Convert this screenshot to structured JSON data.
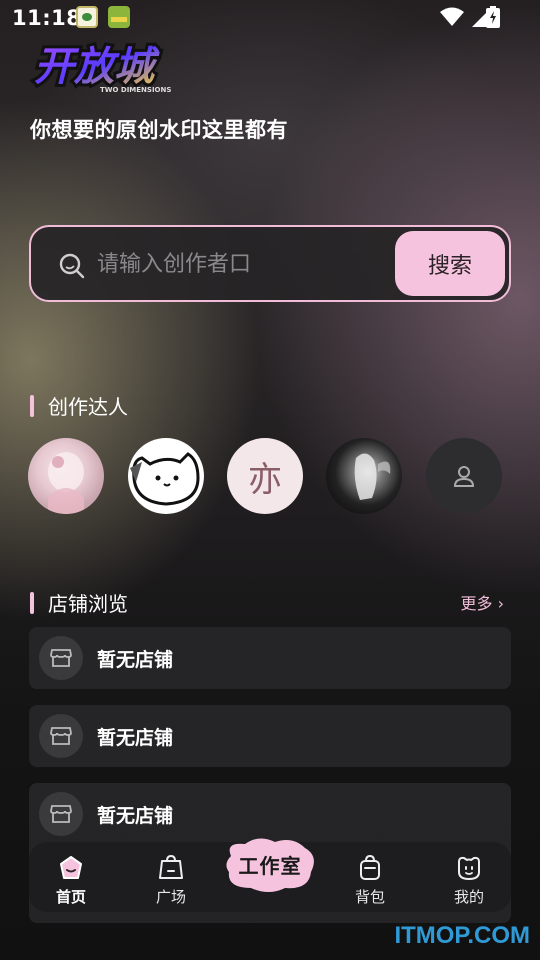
{
  "status_bar": {
    "time": "11:18"
  },
  "header": {
    "logo_text": "开放城",
    "logo_subtext": "TWO DIMENSIONS",
    "tagline": "你想要的原创水印这里都有"
  },
  "search": {
    "placeholder": "请输入创作者口",
    "button_label": "搜索"
  },
  "creators": {
    "title": "创作达人",
    "avatar3_char": "亦"
  },
  "stores": {
    "title": "店铺浏览",
    "more_label": "更多 ›",
    "items": [
      {
        "label": "暂无店铺"
      },
      {
        "label": "暂无店铺"
      },
      {
        "label": "暂无店铺"
      }
    ]
  },
  "bottom_nav": {
    "items": [
      {
        "label": "首页",
        "icon": "home-icon"
      },
      {
        "label": "广场",
        "icon": "bag-icon"
      },
      {
        "label": "背包",
        "icon": "backpack-icon"
      },
      {
        "label": "我的",
        "icon": "face-icon"
      }
    ],
    "studio_label": "工作室"
  },
  "watermark": "ITMOP.COM",
  "colors": {
    "accent": "#f6c3df",
    "card": "#262628",
    "nav": "#1d1c1e"
  }
}
